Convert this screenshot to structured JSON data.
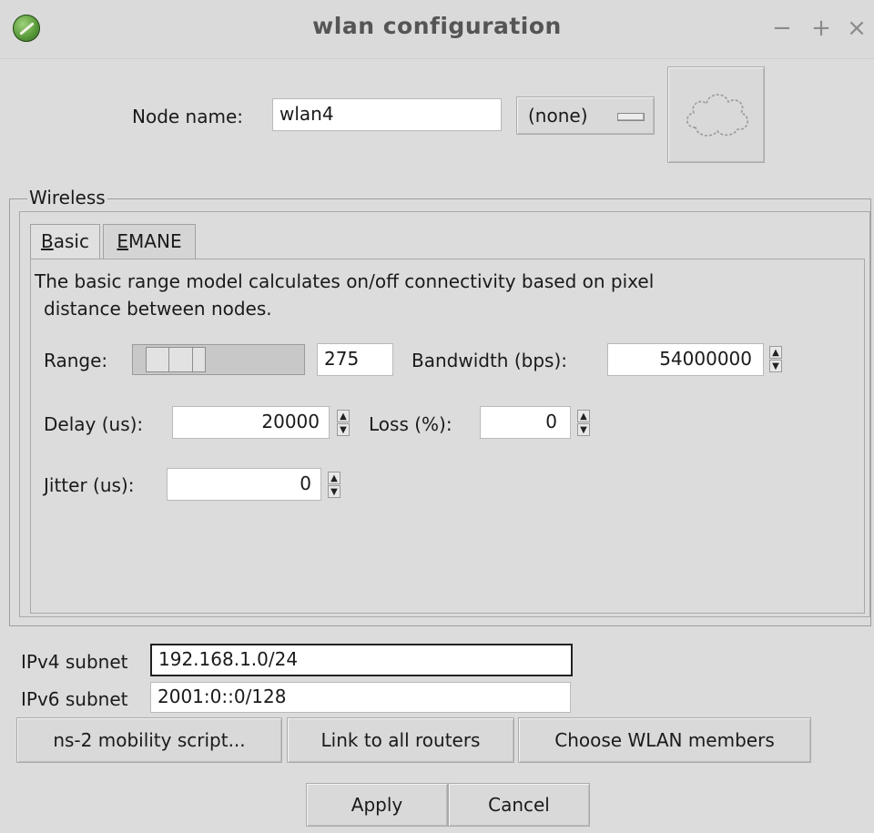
{
  "window": {
    "title": "wlan configuration",
    "minimize_glyph": "−",
    "maximize_glyph": "+",
    "close_glyph": "×"
  },
  "node": {
    "name_label": "Node name:",
    "name_value": "wlan4",
    "canvas_select": "(none)",
    "icon": "cloud-icon"
  },
  "wireless": {
    "legend": "Wireless",
    "tabs": [
      {
        "label": "Basic",
        "mnemonic": "B",
        "rest": "asic",
        "active": true
      },
      {
        "label": "EMANE",
        "mnemonic": "E",
        "rest": "MANE",
        "active": false
      }
    ],
    "basic": {
      "description_line1": "The basic range model calculates on/off connectivity based on pixel",
      "description_line2": "distance between nodes.",
      "range_label": "Range:",
      "range_value": "275",
      "bandwidth_label": "Bandwidth (bps):",
      "bandwidth_value": "54000000",
      "delay_label": "Delay (us):",
      "delay_value": "20000",
      "loss_label": "Loss (%):",
      "loss_value": "0",
      "jitter_label": "Jitter (us):",
      "jitter_value": "0"
    }
  },
  "subnets": {
    "ipv4_label": "IPv4 subnet",
    "ipv4_value": "192.168.1.0/24",
    "ipv6_label": "IPv6 subnet",
    "ipv6_value": "2001:0::0/128"
  },
  "actions": {
    "ns2_label": "ns-2 mobility script...",
    "link_routers_label": "Link to all routers",
    "wlan_members_label": "Choose WLAN members",
    "apply_label": "Apply",
    "cancel_label": "Cancel"
  }
}
